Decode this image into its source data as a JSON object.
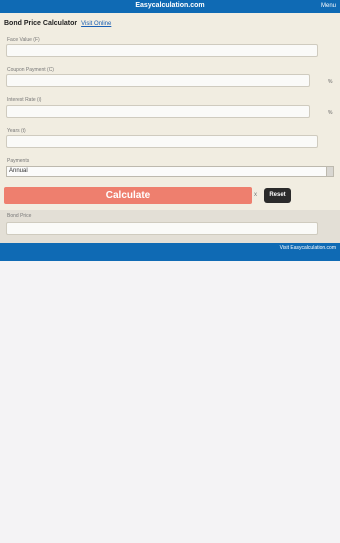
{
  "header": {
    "site_title": "Easycalculation.com",
    "menu_label": "Menu"
  },
  "calculator": {
    "title": "Bond Price Calculator",
    "visit_link": "Visit Online",
    "fields": [
      {
        "label": "Face Value (F)",
        "value": "",
        "unit": ""
      },
      {
        "label": "Coupon Payment (C)",
        "value": "",
        "unit": "%"
      },
      {
        "label": "Interest Rate (i)",
        "value": "",
        "unit": "%"
      },
      {
        "label": "Years (t)",
        "value": "",
        "unit": ""
      }
    ],
    "payments": {
      "label": "Payments",
      "selected": "Annual"
    },
    "calculate_label": "Calculate",
    "separator": "x",
    "reset_label": "Reset",
    "result": {
      "label": "Bond Price",
      "value": ""
    }
  },
  "footer": {
    "link_text": "Visit Easycalculation.com"
  }
}
